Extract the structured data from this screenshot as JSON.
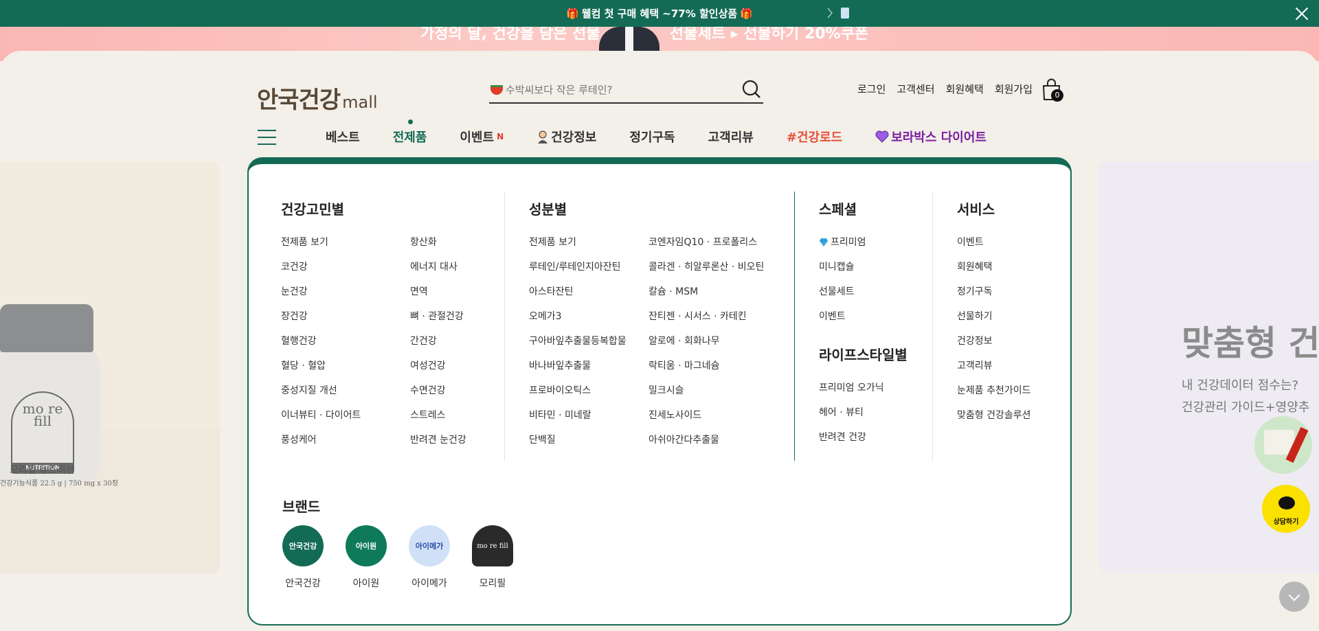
{
  "promo": {
    "text": "웰컴 첫 구매 혜택 ~77% 할인상품",
    "gift_icon": "🎁"
  },
  "hero": {
    "left_text": "가정의 달, 건강을 담은 선물",
    "right_text": "선물세트 ▸ 선물하기 20%쿠폰"
  },
  "header": {
    "logo_main": "안국건강",
    "logo_sub": "mall",
    "search_placeholder": "수박씨보다 작은 루테인?",
    "util": [
      "로그인",
      "고객센터",
      "회원혜택",
      "회원가입"
    ],
    "cart_count": "0"
  },
  "gnb": {
    "items": [
      "베스트",
      "전제품",
      "이벤트",
      "건강정보",
      "정기구독",
      "고객리뷰",
      "#건강로드",
      "보라박스 다이어트"
    ],
    "new_badge": "N",
    "active": "전제품"
  },
  "mega": {
    "health": {
      "title": "건강고민별",
      "col1": [
        "전제품 보기",
        "코건강",
        "눈건강",
        "장건강",
        "혈행건강",
        "혈당 · 혈압",
        "중성지질 개선",
        "이너뷰티 · 다이어트",
        "풍성케어"
      ],
      "col2": [
        "항산화",
        "에너지 대사",
        "면역",
        "뼈 · 관절건강",
        "간건강",
        "여성건강",
        "수면건강",
        "스트레스",
        "반려견 눈건강"
      ]
    },
    "ingredient": {
      "title": "성분별",
      "col1": [
        "전제품 보기",
        "루테인/루테인지아잔틴",
        "아스타잔틴",
        "오메가3",
        "구아바잎추출물등복합물",
        "바나바잎추출물",
        "프로바이오틱스",
        "비타민 · 미네랄",
        "단백질"
      ],
      "col2": [
        "코엔자임Q10 · 프로폴리스",
        "콜라겐 · 히알루론산 · 비오틴",
        "칼슘 · MSM",
        "잔티젠 · 시서스 · 카테킨",
        "알로에 · 회화나무",
        "락티움 · 마그네슘",
        "밀크시슬",
        "진세노사이드",
        "아쉬아간다추출물"
      ]
    },
    "special": {
      "title": "스페셜",
      "items": [
        "프리미엄",
        "미니캡슐",
        "선물세트",
        "이벤트"
      ]
    },
    "lifestyle": {
      "title": "라이프스타일별",
      "items": [
        "프리미엄 오가닉",
        "헤어 · 뷰티",
        "반려견 건강"
      ]
    },
    "service": {
      "title": "서비스",
      "items": [
        "이벤트",
        "회원혜택",
        "정기구독",
        "선물하기",
        "건강정보",
        "고객리뷰",
        "눈제품 추천가이드",
        "맞춤형 건강솔루션"
      ]
    },
    "brand": {
      "title": "브랜드",
      "items": [
        {
          "name": "안국건강",
          "logo_text": "안국건강",
          "color": "#146b55"
        },
        {
          "name": "아이원",
          "logo_text": "아이원",
          "color": "#0f7a5a"
        },
        {
          "name": "아이메가",
          "logo_text": "아이메가",
          "color": "#cfe0f7"
        },
        {
          "name": "모리필",
          "logo_text": "mo re fill",
          "color": "#2a2a2a"
        }
      ]
    }
  },
  "side_left": {
    "product_name": "모리필 뉴트리션",
    "product_spec": "건강기능식품 22.5 g | 750 mg x 30정",
    "badge_text": "mo re fill",
    "badge_label": "NUTRITION"
  },
  "side_right": {
    "title": "맞춤형 건",
    "sub1": "내 건강데이터 점수는?",
    "sub2": "건강관리 가이드+영양추"
  },
  "floaters": {
    "chat_label": "상담하기"
  },
  "colors": {
    "brand_green": "#146b55",
    "promo_bg": "#146b55",
    "road_red": "#e5503a",
    "bora_purple": "#7a1fa2",
    "kakao_yellow": "#fae100"
  }
}
